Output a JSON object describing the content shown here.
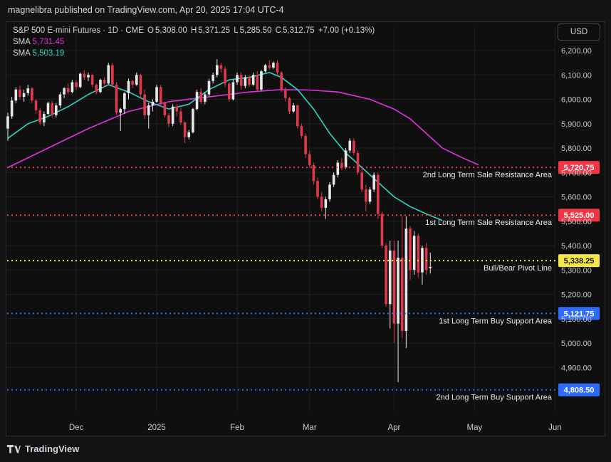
{
  "header": {
    "publisher_line": "magnelibra published on TradingView.com, Apr 20, 2025 17:04 UTC-4"
  },
  "legend": {
    "symbol": "S&P 500 E-mini Futures · 1D · CME",
    "open_label": "O",
    "open": "5,308.00",
    "high_label": "H",
    "high": "5,371.25",
    "low_label": "L",
    "low": "5,285.50",
    "close_label": "C",
    "close": "5,312.75",
    "change": "+7.00 (+0.13%)",
    "sma1_label": "SMA",
    "sma1_value": "5,731.45",
    "sma2_label": "SMA",
    "sma2_value": "5,503.19"
  },
  "currency_button": "USD",
  "footer": {
    "brand": "TradingView"
  },
  "colors": {
    "up": "#e8e8e8",
    "down": "#e0384c",
    "sma1": "#e030e0",
    "sma2": "#26d7c4",
    "resistance": "#f23645",
    "pivot": "#f5e64a",
    "support": "#2f6bff",
    "grid": "#1f1f1f",
    "axis_text": "#c8c8c8"
  },
  "chart_data": {
    "type": "candlestick",
    "symbol": "S&P 500 E-mini Futures",
    "interval": "1D",
    "ylim": [
      4800,
      6250
    ],
    "y_ticks": [
      "6,200.00",
      "6,100.00",
      "6,000.00",
      "5,900.00",
      "5,800.00",
      "5,700.00",
      "5,600.00",
      "5,500.00",
      "5,400.00",
      "5,300.00",
      "5,200.00",
      "5,100.00",
      "5,000.00",
      "4,900.00"
    ],
    "x_ticks": [
      "Dec",
      "2025",
      "Feb",
      "Mar",
      "Apr",
      "May",
      "Jun"
    ],
    "levels": [
      {
        "value": 5720.75,
        "price_label": "5,720.75",
        "label": "2nd Long Term Sale Resistance Area",
        "kind": "resistance"
      },
      {
        "value": 5525.0,
        "price_label": "5,525.00",
        "label": "1st Long Term Sale Resistance Area",
        "kind": "resistance"
      },
      {
        "value": 5338.25,
        "price_label": "5,338.25",
        "label": "Bull/Bear Pivot Line",
        "kind": "pivot"
      },
      {
        "value": 5121.75,
        "price_label": "5,121.75",
        "label": "1st Long Term Buy Support Area",
        "kind": "support"
      },
      {
        "value": 4808.5,
        "price_label": "4,808.50",
        "label": "2nd Long Term Buy Support Area",
        "kind": "support"
      }
    ],
    "candles": [
      [
        5880,
        5945,
        5830,
        5930
      ],
      [
        5930,
        6010,
        5920,
        5995
      ],
      [
        5995,
        6050,
        5985,
        6040
      ],
      [
        6040,
        6055,
        6000,
        6010
      ],
      [
        6010,
        6040,
        5990,
        6025
      ],
      [
        6025,
        6060,
        6015,
        6045
      ],
      [
        6045,
        6050,
        5985,
        5995
      ],
      [
        5995,
        6000,
        5940,
        5955
      ],
      [
        5955,
        5965,
        5895,
        5905
      ],
      [
        5905,
        5950,
        5890,
        5940
      ],
      [
        5940,
        5990,
        5935,
        5985
      ],
      [
        5985,
        5995,
        5925,
        5935
      ],
      [
        5935,
        5985,
        5925,
        5975
      ],
      [
        5975,
        6030,
        5965,
        6020
      ],
      [
        6020,
        6050,
        6005,
        6045
      ],
      [
        6045,
        6065,
        6020,
        6030
      ],
      [
        6030,
        6080,
        6025,
        6070
      ],
      [
        6070,
        6080,
        6040,
        6050
      ],
      [
        6050,
        6110,
        6045,
        6105
      ],
      [
        6105,
        6120,
        6080,
        6090
      ],
      [
        6090,
        6110,
        6075,
        6100
      ],
      [
        6100,
        6105,
        6050,
        6060
      ],
      [
        6060,
        6065,
        6020,
        6030
      ],
      [
        6030,
        6085,
        6025,
        6080
      ],
      [
        6080,
        6090,
        6050,
        6065
      ],
      [
        6065,
        6150,
        6060,
        6140
      ],
      [
        6140,
        6150,
        6050,
        6060
      ],
      [
        6060,
        6070,
        5935,
        5945
      ],
      [
        5945,
        5965,
        5870,
        5960
      ],
      [
        5960,
        6030,
        5940,
        6025
      ],
      [
        6025,
        6085,
        6000,
        6075
      ],
      [
        6075,
        6080,
        6045,
        6060
      ],
      [
        6060,
        6110,
        6055,
        6100
      ],
      [
        6100,
        6105,
        6010,
        6020
      ],
      [
        6020,
        6040,
        5920,
        5935
      ],
      [
        5935,
        5985,
        5880,
        5975
      ],
      [
        5975,
        6000,
        5950,
        5990
      ],
      [
        5990,
        6060,
        5985,
        6050
      ],
      [
        6050,
        6060,
        5970,
        5985
      ],
      [
        5985,
        5990,
        5925,
        5935
      ],
      [
        5935,
        5945,
        5885,
        5900
      ],
      [
        5900,
        5980,
        5890,
        5970
      ],
      [
        5970,
        5980,
        5930,
        5950
      ],
      [
        5950,
        5965,
        5895,
        5905
      ],
      [
        5905,
        5910,
        5820,
        5845
      ],
      [
        5845,
        5875,
        5835,
        5865
      ],
      [
        5865,
        5965,
        5860,
        5960
      ],
      [
        5960,
        6040,
        5955,
        6030
      ],
      [
        6030,
        6045,
        5980,
        5990
      ],
      [
        5990,
        6030,
        5980,
        6020
      ],
      [
        6020,
        6085,
        6010,
        6075
      ],
      [
        6075,
        6110,
        6065,
        6100
      ],
      [
        6100,
        6165,
        6090,
        6140
      ],
      [
        6140,
        6150,
        6110,
        6125
      ],
      [
        6125,
        6135,
        6050,
        6065
      ],
      [
        6065,
        6070,
        5990,
        6000
      ],
      [
        6000,
        6080,
        5995,
        6070
      ],
      [
        6070,
        6110,
        6060,
        6100
      ],
      [
        6100,
        6110,
        6040,
        6055
      ],
      [
        6055,
        6100,
        6045,
        6090
      ],
      [
        6090,
        6100,
        6050,
        6060
      ],
      [
        6060,
        6110,
        6055,
        6100
      ],
      [
        6100,
        6115,
        6030,
        6040
      ],
      [
        6040,
        6120,
        6035,
        6115
      ],
      [
        6115,
        6145,
        6110,
        6140
      ],
      [
        6140,
        6160,
        6120,
        6130
      ],
      [
        6130,
        6155,
        6125,
        6150
      ],
      [
        6150,
        6160,
        6100,
        6110
      ],
      [
        6110,
        6115,
        6030,
        6040
      ],
      [
        6040,
        6050,
        5990,
        6005
      ],
      [
        6005,
        6010,
        5940,
        5950
      ],
      [
        5950,
        5985,
        5945,
        5975
      ],
      [
        5975,
        5980,
        5880,
        5890
      ],
      [
        5890,
        5900,
        5840,
        5850
      ],
      [
        5850,
        5860,
        5760,
        5775
      ],
      [
        5775,
        5790,
        5720,
        5730
      ],
      [
        5730,
        5740,
        5650,
        5665
      ],
      [
        5665,
        5680,
        5590,
        5600
      ],
      [
        5600,
        5620,
        5540,
        5555
      ],
      [
        5555,
        5600,
        5510,
        5590
      ],
      [
        5590,
        5660,
        5580,
        5650
      ],
      [
        5650,
        5700,
        5640,
        5690
      ],
      [
        5690,
        5750,
        5680,
        5740
      ],
      [
        5740,
        5760,
        5710,
        5720
      ],
      [
        5720,
        5800,
        5715,
        5790
      ],
      [
        5790,
        5840,
        5780,
        5830
      ],
      [
        5830,
        5840,
        5770,
        5780
      ],
      [
        5780,
        5790,
        5690,
        5700
      ],
      [
        5700,
        5720,
        5620,
        5630
      ],
      [
        5630,
        5650,
        5540,
        5580
      ],
      [
        5580,
        5640,
        5570,
        5630
      ],
      [
        5630,
        5700,
        5620,
        5690
      ],
      [
        5690,
        5700,
        5510,
        5530
      ],
      [
        5530,
        5540,
        5390,
        5400
      ],
      [
        5400,
        5410,
        5150,
        5160
      ],
      [
        5160,
        5420,
        5060,
        5380
      ],
      [
        5380,
        5420,
        5000,
        5080
      ],
      [
        5080,
        5420,
        4840,
        5350
      ],
      [
        5350,
        5520,
        5020,
        5050
      ],
      [
        5050,
        5520,
        4980,
        5470
      ],
      [
        5470,
        5480,
        5260,
        5300
      ],
      [
        5300,
        5460,
        5280,
        5440
      ],
      [
        5440,
        5450,
        5270,
        5290
      ],
      [
        5290,
        5400,
        5240,
        5390
      ],
      [
        5390,
        5410,
        5280,
        5300
      ],
      [
        5308,
        5371.25,
        5285.5,
        5312.75
      ]
    ],
    "series": [
      {
        "name": "SMA",
        "last": 5731.45,
        "x": [
          0,
          10,
          20,
          30,
          40,
          50,
          60,
          68,
          75,
          82,
          90,
          96,
          100,
          104,
          108,
          113,
          117
        ],
        "y": [
          5720,
          5800,
          5880,
          5950,
          5990,
          6010,
          6030,
          6040,
          6038,
          6030,
          6000,
          5960,
          5920,
          5860,
          5800,
          5760,
          5731
        ]
      },
      {
        "name": "SMA",
        "last": 5503.19,
        "x": [
          0,
          5,
          10,
          15,
          20,
          25,
          30,
          35,
          40,
          45,
          50,
          55,
          60,
          65,
          68,
          72,
          76,
          80,
          84,
          88,
          92,
          96,
          100,
          104,
          108
        ],
        "y": [
          5840,
          5900,
          5930,
          5970,
          6020,
          6060,
          6030,
          5990,
          5960,
          5980,
          6040,
          6080,
          6090,
          6110,
          6090,
          6040,
          5960,
          5860,
          5780,
          5720,
          5660,
          5600,
          5560,
          5530,
          5503
        ]
      }
    ]
  }
}
